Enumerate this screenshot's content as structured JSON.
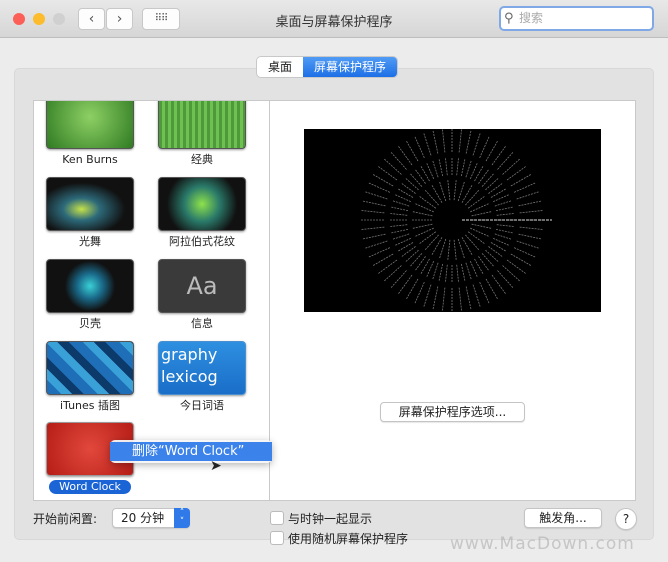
{
  "window": {
    "title": "桌面与屏幕保护程序",
    "search_placeholder": "搜索"
  },
  "tabs": [
    {
      "label": "桌面",
      "selected": false
    },
    {
      "label": "屏幕保护程序",
      "selected": true
    }
  ],
  "screensavers": [
    {
      "name": "Ken Burns"
    },
    {
      "name": "经典"
    },
    {
      "name": "光舞"
    },
    {
      "name": "阿拉伯式花纹"
    },
    {
      "name": "贝壳"
    },
    {
      "name": "信息",
      "thumb_text": "Aa"
    },
    {
      "name": "iTunes 插图"
    },
    {
      "name": "今日词语",
      "thumb_text": "graphy lexicog"
    },
    {
      "name": "Word Clock",
      "selected": true
    }
  ],
  "context_menu": {
    "item": "删除“Word Clock”"
  },
  "options_button": "屏幕保护程序选项...",
  "idle": {
    "label": "开始前闲置:",
    "value": "20 分钟"
  },
  "checkboxes": [
    {
      "label": "与时钟一起显示",
      "checked": false
    },
    {
      "label": "使用随机屏幕保护程序",
      "checked": false
    }
  ],
  "hot_corners_button": "触发角...",
  "help_button": "?",
  "watermark": "www.MacDown.com"
}
